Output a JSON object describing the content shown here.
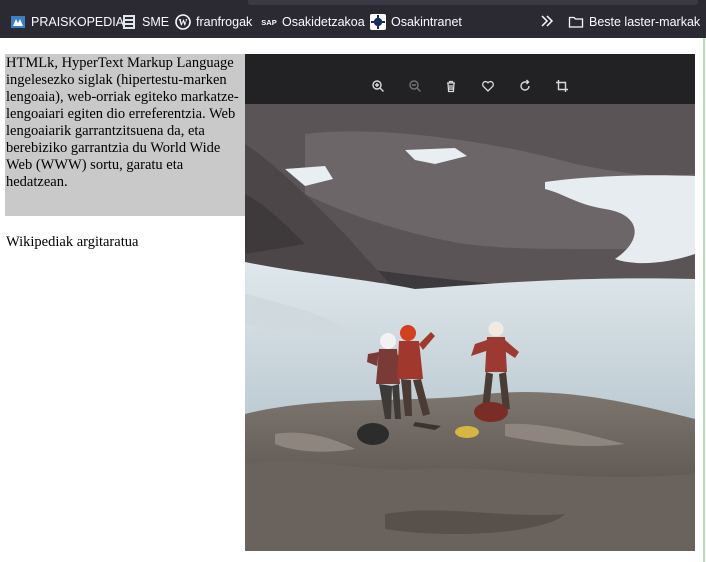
{
  "bookmarks": {
    "items": [
      {
        "label": "PRAISKOPEDIA",
        "icon": "praiskopedia-icon"
      },
      {
        "label": "SME",
        "icon": "sme-icon"
      },
      {
        "label": "franfrogak",
        "icon": "wordpress-icon"
      },
      {
        "label": "Osakidetzakoa",
        "icon": "sap-icon"
      },
      {
        "label": "Osakintranet",
        "icon": "osakintranet-icon"
      }
    ],
    "overflow_icon": "chevron-double-right-icon",
    "other_bookmarks": {
      "label": "Beste laster-markak",
      "icon": "folder-icon"
    }
  },
  "article": {
    "paragraph": "HTMLk, HyperText Markup Language ingelesezko siglak (hipertestu-marken lengoaia), web-orriak egiteko markatze-lengoaiari egiten dio erreferentzia. Web lengoaiarik garrantzitsuena da, eta berebiziko garrantzia du World Wide Web (WWW) sortu, garatu eta hedatzean.",
    "credit": "Wikipediak argitaratua"
  },
  "viewer": {
    "tools": [
      "zoom-in-icon",
      "zoom-out-icon",
      "trash-icon",
      "heart-icon",
      "rotate-icon",
      "crop-icon"
    ],
    "image_subject": "three-mountaineers-on-glacier-rock"
  },
  "colors": {
    "toolbar_bg": "#2b2a33",
    "toolbar_text": "#fbfbfe",
    "highlight_bg": "#c9c9c9",
    "viewer_bg": "#222225"
  }
}
